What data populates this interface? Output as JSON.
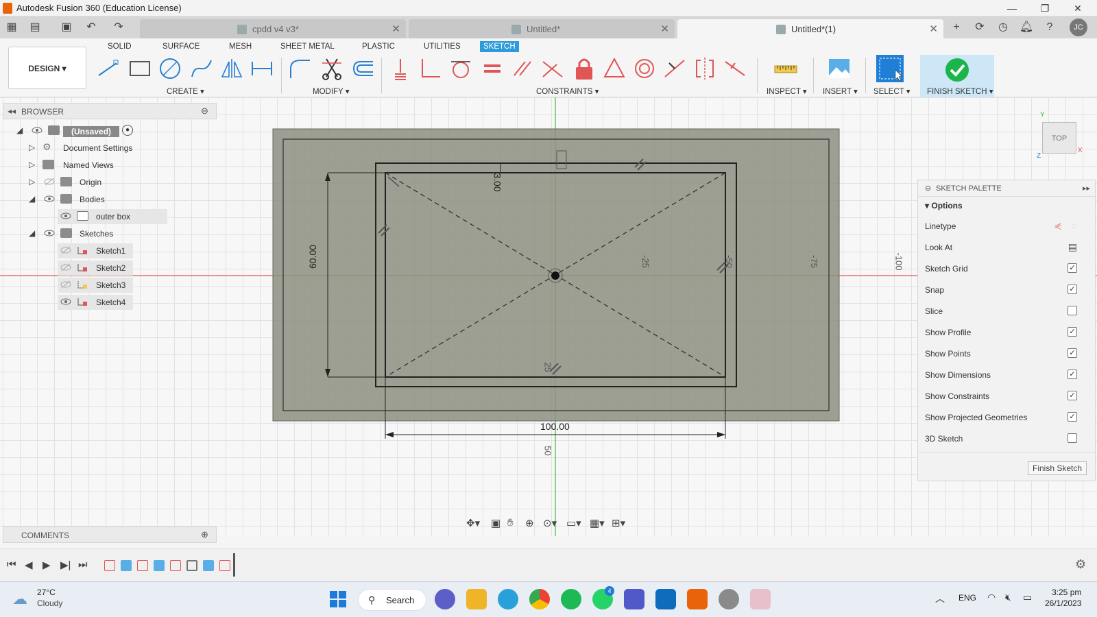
{
  "window": {
    "title": "Autodesk Fusion 360 (Education License)"
  },
  "tabs": [
    {
      "label": "cpdd v4 v3*",
      "active": false
    },
    {
      "label": "Untitled*",
      "active": false
    },
    {
      "label": "Untitled*(1)",
      "active": true
    }
  ],
  "user_initials": "JC",
  "workspace": {
    "label": "DESIGN"
  },
  "ribbon_tabs": [
    "SOLID",
    "SURFACE",
    "MESH",
    "SHEET METAL",
    "PLASTIC",
    "UTILITIES",
    "SKETCH"
  ],
  "active_ribbon_tab": "SKETCH",
  "groups": {
    "create": "CREATE",
    "modify": "MODIFY",
    "constraints": "CONSTRAINTS",
    "inspect": "INSPECT",
    "insert": "INSERT",
    "select": "SELECT",
    "finish": "FINISH SKETCH"
  },
  "browser": {
    "title": "BROWSER",
    "root": "(Unsaved)",
    "items": [
      {
        "label": "Document Settings"
      },
      {
        "label": "Named Views"
      },
      {
        "label": "Origin"
      },
      {
        "label": "Bodies"
      },
      {
        "label": "outer box"
      },
      {
        "label": "Sketches"
      },
      {
        "label": "Sketch1"
      },
      {
        "label": "Sketch2"
      },
      {
        "label": "Sketch3"
      },
      {
        "label": "Sketch4"
      }
    ]
  },
  "comments": {
    "label": "COMMENTS"
  },
  "viewcube": {
    "face": "TOP",
    "y": "Y",
    "x": "X",
    "z": "Z"
  },
  "dimensions": {
    "width": "100.00",
    "height": "60.00",
    "top_small": "3.00"
  },
  "grid_labels": {
    "l25": "-25",
    "l50": "-50",
    "l75": "-75",
    "l100": "-100",
    "b25": "25",
    "b50": "50"
  },
  "palette": {
    "title": "SKETCH PALETTE",
    "section": "Options",
    "rows": [
      {
        "label": "Linetype",
        "checked": null
      },
      {
        "label": "Look At",
        "checked": null
      },
      {
        "label": "Sketch Grid",
        "checked": true
      },
      {
        "label": "Snap",
        "checked": true
      },
      {
        "label": "Slice",
        "checked": false
      },
      {
        "label": "Show Profile",
        "checked": true
      },
      {
        "label": "Show Points",
        "checked": true
      },
      {
        "label": "Show Dimensions",
        "checked": true
      },
      {
        "label": "Show Constraints",
        "checked": true
      },
      {
        "label": "Show Projected Geometries",
        "checked": true
      },
      {
        "label": "3D Sketch",
        "checked": false
      }
    ],
    "finish_button": "Finish Sketch"
  },
  "taskbar": {
    "weather_temp": "27°C",
    "weather_desc": "Cloudy",
    "search": "Search",
    "lang": "ENG",
    "time": "3:25 pm",
    "date": "26/1/2023",
    "badge_whatsapp": "4"
  },
  "colors": {
    "sketch_blue": "#2e9cdb",
    "finish_green": "#1bb54a",
    "axis_red": "#e05555",
    "axis_green": "#44bb44"
  }
}
